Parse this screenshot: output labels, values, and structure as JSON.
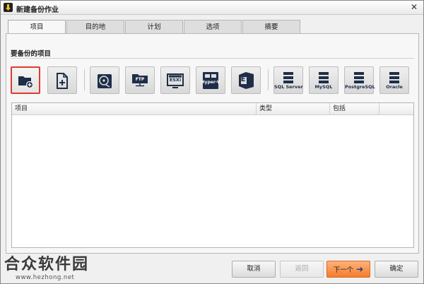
{
  "window": {
    "title": "新建备份作业",
    "close_glyph": "✕"
  },
  "tabs": [
    {
      "label": "项目",
      "active": true
    },
    {
      "label": "目的地",
      "active": false
    },
    {
      "label": "计划",
      "active": false
    },
    {
      "label": "选项",
      "active": false
    },
    {
      "label": "摘要",
      "active": false
    }
  ],
  "section": {
    "title": "要备份的项目"
  },
  "toolbar": [
    {
      "icon": "folder-plus-icon",
      "label": "",
      "selected": true
    },
    {
      "icon": "file-plus-icon",
      "label": "",
      "selected": false
    },
    {
      "icon": "disk-icon",
      "label": "",
      "selected": false
    },
    {
      "icon": "ftp-icon",
      "label": "FTP",
      "selected": false
    },
    {
      "icon": "esxi-icon",
      "label": "ESXi",
      "selected": false
    },
    {
      "icon": "hyperv-icon",
      "label": "Hyper-V",
      "selected": false
    },
    {
      "icon": "exchange-icon",
      "label": "E",
      "selected": false
    },
    {
      "icon": "database-icon",
      "label": "SQL Server",
      "selected": false
    },
    {
      "icon": "database-icon",
      "label": "MySQL",
      "selected": false
    },
    {
      "icon": "database-icon",
      "label": "PostgreSQL",
      "selected": false
    },
    {
      "icon": "database-icon",
      "label": "Oracle",
      "selected": false
    }
  ],
  "table": {
    "columns": [
      "项目",
      "类型",
      "包括"
    ],
    "rows": []
  },
  "buttons": {
    "cancel": "取消",
    "back": "返回",
    "next": "下一个",
    "next_arrow": "➜",
    "ok": "确定"
  },
  "watermark": {
    "name": "合众软件园",
    "url": "www.hezhong.net"
  },
  "colors": {
    "selected_border": "#e03a2f",
    "primary_button": "#f37c2c",
    "icon_navy": "#1e2e48"
  }
}
